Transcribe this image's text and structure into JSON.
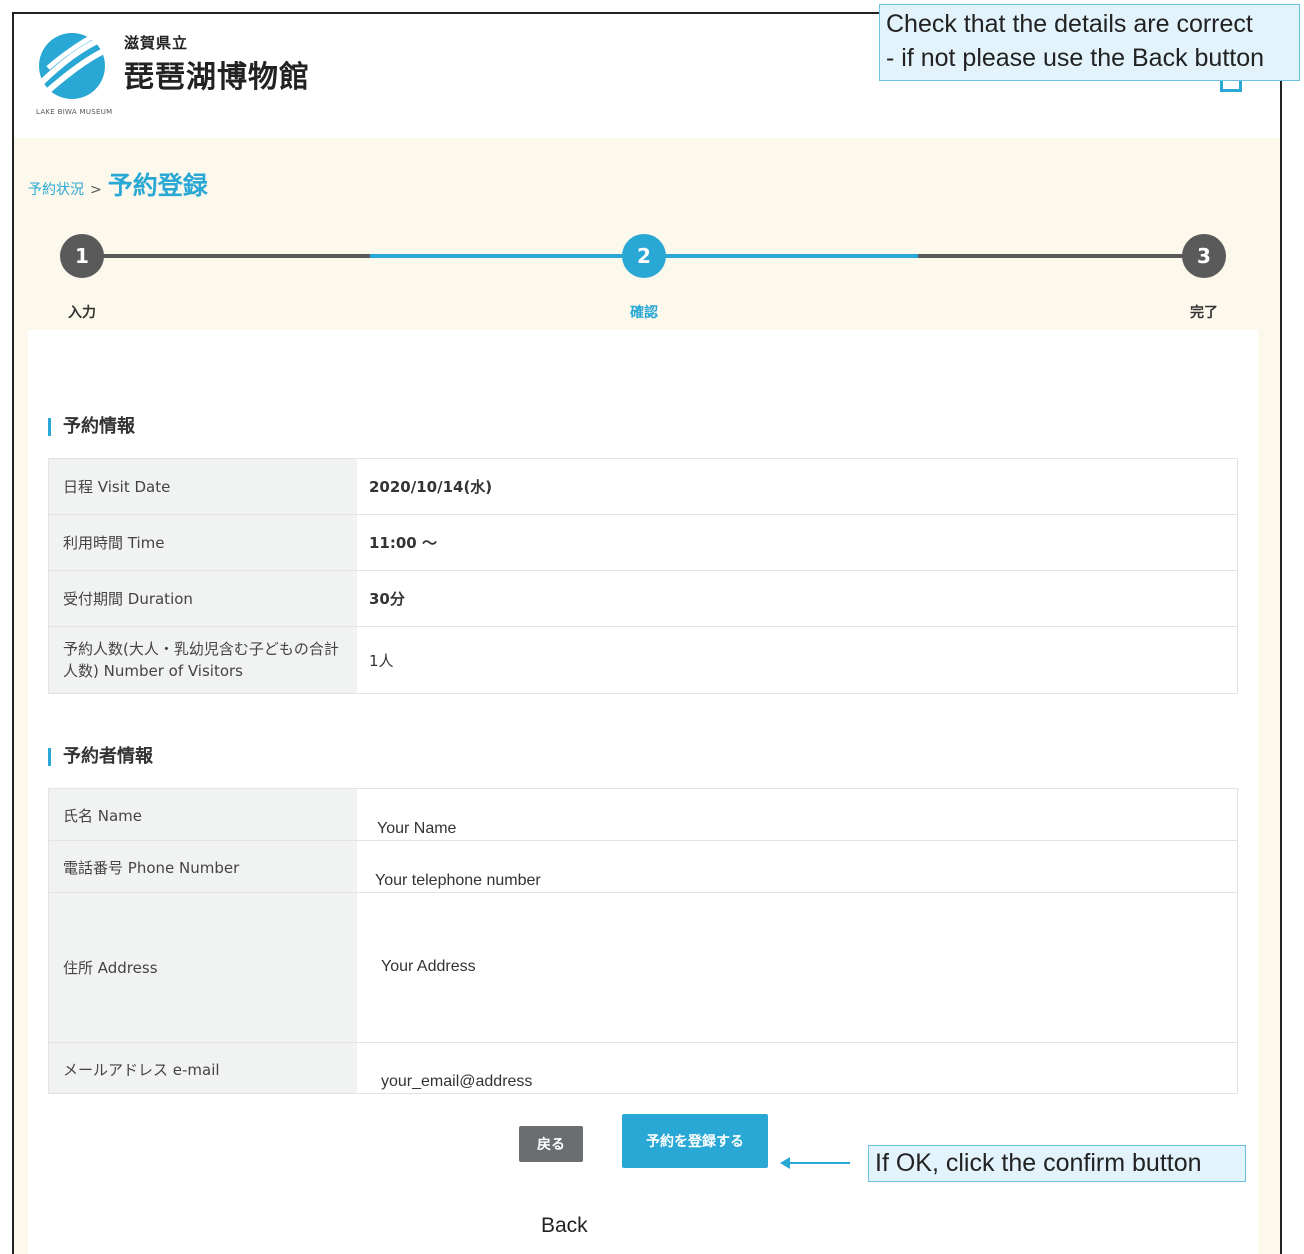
{
  "header": {
    "logo_small": "滋賀県立",
    "logo_big": "琵琶湖博物館",
    "logo_sub": "LAKE BIWA MUSEUM"
  },
  "breadcrumb": {
    "parent": "予約状況",
    "separator": ">",
    "current": "予約登録"
  },
  "stepper": {
    "steps": [
      {
        "number": "1",
        "label": "入力",
        "state": "done"
      },
      {
        "number": "2",
        "label": "確認",
        "state": "active"
      },
      {
        "number": "3",
        "label": "完了",
        "state": "pending"
      }
    ]
  },
  "reservation": {
    "title": "予約情報",
    "rows": [
      {
        "label": "日程 Visit Date",
        "value": "2020/10/14(水)"
      },
      {
        "label": "利用時間 Time",
        "value": "11:00 ～"
      },
      {
        "label": "受付期間 Duration",
        "value": "30分"
      },
      {
        "label": "予約人数(大人・乳幼児含む子どもの合計人数) Number of Visitors",
        "value": "1人"
      }
    ]
  },
  "customer": {
    "title": "予約者情報",
    "rows": [
      {
        "label": "氏名 Name",
        "value": "Your Name"
      },
      {
        "label": "電話番号 Phone Number",
        "value": "Your telephone number"
      },
      {
        "label": "住所 Address",
        "value": "Your Address"
      },
      {
        "label": "メールアドレス e-mail",
        "value": "your_email@address"
      }
    ]
  },
  "buttons": {
    "back": "戻る",
    "confirm": "予約を登録する"
  },
  "annotations": {
    "top_line1": "Check that the details are correct",
    "top_line2": "- if not please use the Back button",
    "confirm": "If OK, click the confirm button",
    "back": "Back"
  },
  "colors": {
    "accent": "#29a8d6",
    "step_inactive": "#5a5a5a",
    "back_button": "#6b6e70",
    "background_cream": "#fdf8ec"
  },
  "icons": {
    "logo": "lake-biwa-museum-logo",
    "menu": "menu-icon"
  }
}
